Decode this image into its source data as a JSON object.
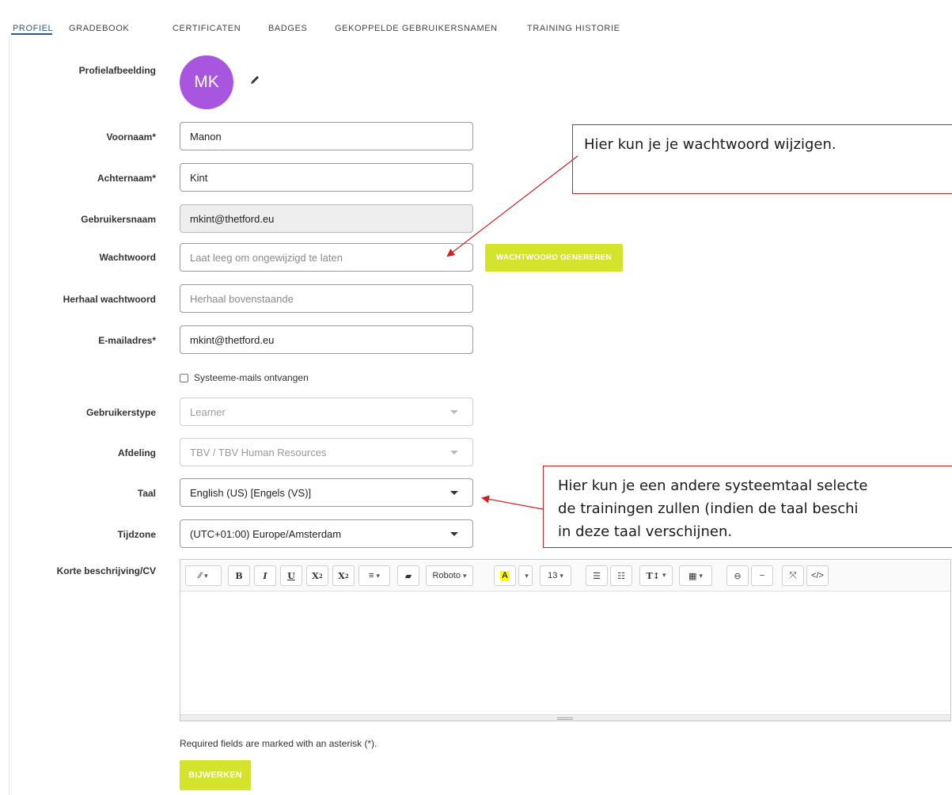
{
  "tabs": [
    "PROFIEL",
    "GRADEBOOK",
    "CERTIFICATEN",
    "BADGES",
    "GEKOPPELDE GEBRUIKERSNAMEN",
    "TRAINING HISTORIE"
  ],
  "profile": {
    "avatar_label": "Profielafbeelding",
    "avatar_initials": "MK",
    "first_name_label": "Voornaam*",
    "first_name_value": "Manon",
    "last_name_label": "Achternaam*",
    "last_name_value": "Kint",
    "username_label": "Gebruikersnaam",
    "username_value": "mkint@thetford.eu",
    "password_label": "Wachtwoord",
    "password_placeholder": "Laat leeg om ongewijzigd te laten",
    "generate_button": "WACHTWOORD GENEREREN",
    "repeat_password_label": "Herhaal wachtwoord",
    "repeat_password_placeholder": "Herhaal bovenstaande",
    "email_label": "E-mailadres*",
    "email_value": "mkint@thetford.eu",
    "system_emails_label": "Systeeme-mails ontvangen",
    "user_type_label": "Gebruikerstype",
    "user_type_value": "Learner",
    "department_label": "Afdeling",
    "department_value": "TBV / TBV Human Resources",
    "language_label": "Taal",
    "language_value": "English (US) [Engels (VS)]",
    "timezone_label": "Tijdzone",
    "timezone_value": "(UTC+01:00) Europe/Amsterdam",
    "bio_label": "Korte beschrijving/CV"
  },
  "editor_toolbar": {
    "font": "Roboto",
    "size": "13",
    "bold": "B",
    "italic": "I",
    "underline": "U",
    "superscript": "X",
    "subscript": "X",
    "highlight": "A",
    "code": "</>"
  },
  "footer": {
    "required_note": "Required fields are marked with an asterisk (*).",
    "update_button": "BIJWERKEN"
  },
  "callouts": {
    "password": "Hier kun je je wachtwoord wijzigen.",
    "language_line1": "Hier kun je een andere systeemtaal selecte",
    "language_line2": "de trainingen zullen (indien de taal beschi",
    "language_line3": "in deze taal verschijnen."
  },
  "colors": {
    "accent_lime": "#d4e32b",
    "avatar_purple": "#a855e0",
    "tab_active": "#2a5b86",
    "callout_red": "#cc2222"
  }
}
